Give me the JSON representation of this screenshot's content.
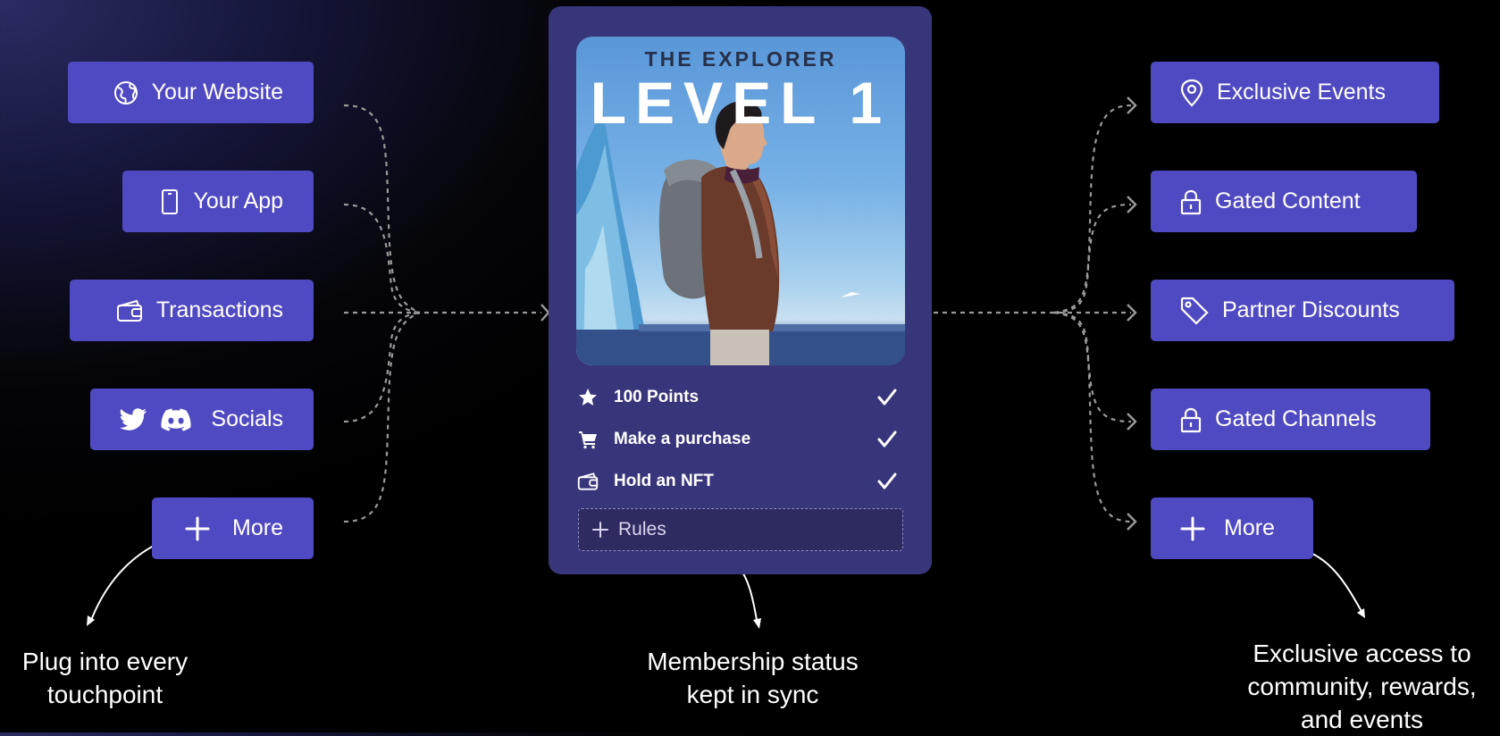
{
  "sources": [
    {
      "label": "Your Website",
      "icon": "globe-icon"
    },
    {
      "label": "Your App",
      "icon": "phone-icon"
    },
    {
      "label": "Transactions",
      "icon": "wallet-icon"
    },
    {
      "label": "Socials",
      "icon": "twitter-discord-icons"
    },
    {
      "label": "More",
      "icon": "plus-icon"
    }
  ],
  "card": {
    "subtitle": "THE EXPLORER",
    "title": "LEVEL 1",
    "rules": [
      {
        "label": "100 Points",
        "icon": "star-icon",
        "checked": true
      },
      {
        "label": "Make a purchase",
        "icon": "cart-icon",
        "checked": true
      },
      {
        "label": "Hold an NFT",
        "icon": "wallet-icon",
        "checked": true
      }
    ],
    "add_rules_label": "Rules"
  },
  "benefits": [
    {
      "label": "Exclusive Events",
      "icon": "location-pin-icon"
    },
    {
      "label": "Gated Content",
      "icon": "lock-icon"
    },
    {
      "label": "Partner Discounts",
      "icon": "tag-icon"
    },
    {
      "label": "Gated Channels",
      "icon": "lock-icon"
    },
    {
      "label": "More",
      "icon": "plus-icon"
    }
  ],
  "captions": {
    "left": "Plug into every touchpoint",
    "center": "Membership status kept in sync",
    "right": "Exclusive access to community, rewards, and events"
  },
  "colors": {
    "pill": "#4f4ac1",
    "card": "#38367a",
    "connector": "#9a9a9a"
  }
}
